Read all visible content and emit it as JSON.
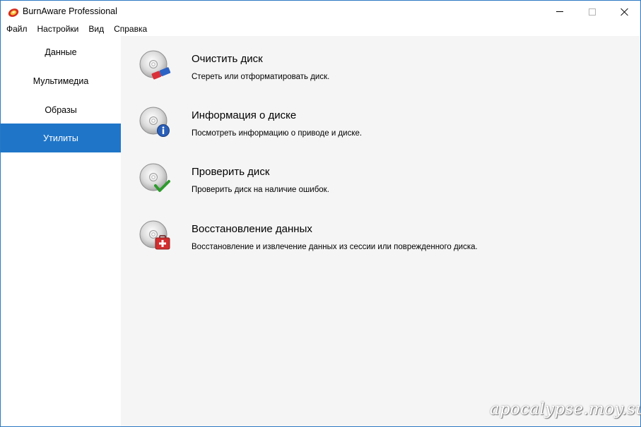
{
  "window": {
    "title": "BurnAware Professional"
  },
  "menu": {
    "items": [
      "Файл",
      "Настройки",
      "Вид",
      "Справка"
    ]
  },
  "sidebar": {
    "items": [
      {
        "label": "Данные",
        "active": false
      },
      {
        "label": "Мультимедиа",
        "active": false
      },
      {
        "label": "Образы",
        "active": false
      },
      {
        "label": "Утилиты",
        "active": true
      }
    ]
  },
  "tools": [
    {
      "title": "Очистить диск",
      "description": "Стереть или отформатировать диск.",
      "icon": "disc-eraser-icon"
    },
    {
      "title": "Информация о диске",
      "description": "Посмотреть информацию о приводе и диске.",
      "icon": "disc-info-icon"
    },
    {
      "title": "Проверить диск",
      "description": "Проверить диск на наличие ошибок.",
      "icon": "disc-check-icon"
    },
    {
      "title": "Восстановление данных",
      "description": "Восстановление и извлечение данных из сессии или поврежденного диска.",
      "icon": "disc-recovery-icon"
    }
  ],
  "watermark": "apocalypse.moy.su",
  "colors": {
    "accent": "#1f76c9",
    "main_background": "#f5f5f5",
    "window_border": "#2b79c2"
  }
}
